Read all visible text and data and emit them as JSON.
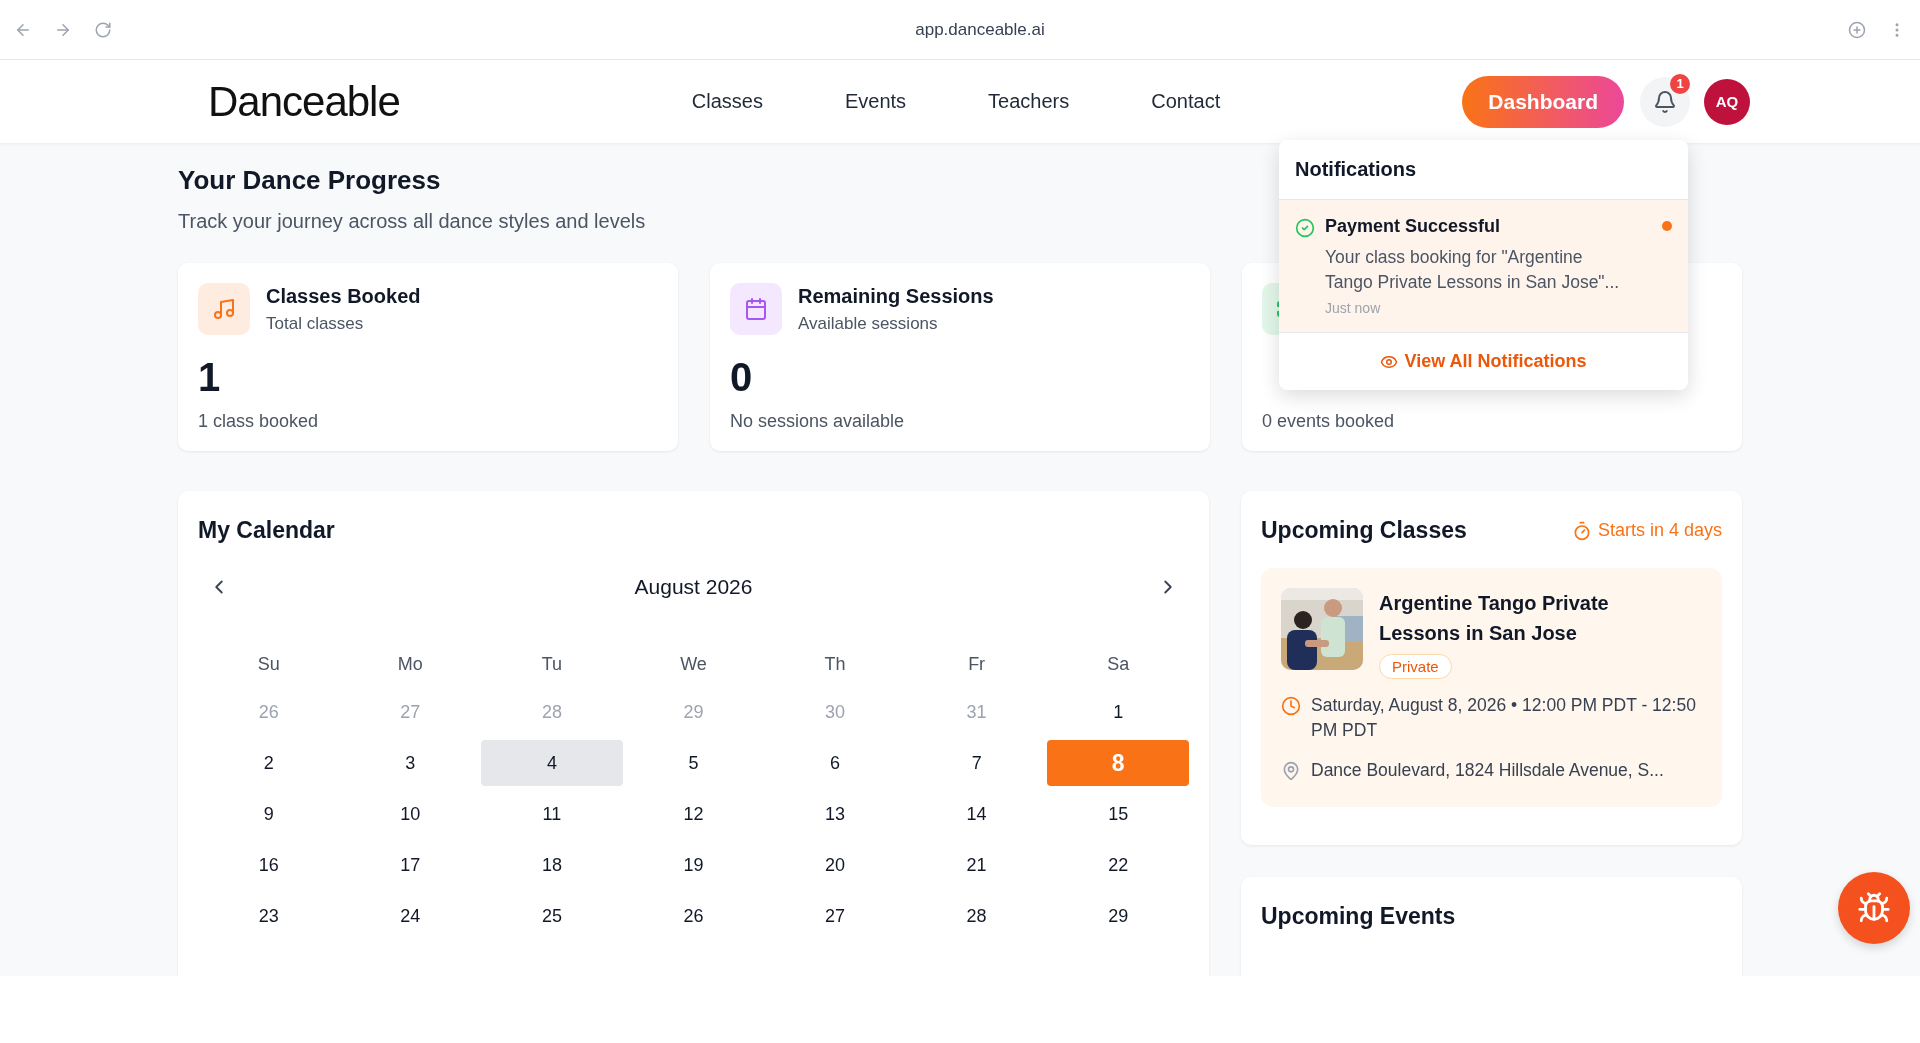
{
  "browser": {
    "url": "app.danceable.ai"
  },
  "header": {
    "logo": "Danceable",
    "nav": [
      {
        "label": "Classes"
      },
      {
        "label": "Events"
      },
      {
        "label": "Teachers"
      },
      {
        "label": "Contact"
      }
    ],
    "dashboard_button": "Dashboard",
    "notification_count": "1",
    "avatar": "AQ"
  },
  "progress": {
    "title": "Your Dance Progress",
    "subtitle": "Track your journey across all dance styles and levels",
    "cards": [
      {
        "kind": "music",
        "color": "#f97316",
        "title": "Classes Booked",
        "subtitle": "Total classes",
        "value": "1",
        "note": "1 class booked"
      },
      {
        "kind": "calendar",
        "color": "#a855f7",
        "title": "Remaining Sessions",
        "subtitle": "Available sessions",
        "value": "0",
        "note": "No sessions available"
      },
      {
        "kind": "ticket",
        "color": "#22c55e",
        "note": "0 events booked"
      }
    ]
  },
  "calendar": {
    "title": "My Calendar",
    "month": "August 2026",
    "weekdays": [
      "Su",
      "Mo",
      "Tu",
      "We",
      "Th",
      "Fr",
      "Sa"
    ],
    "weeks": [
      [
        {
          "day": "26",
          "kind": "outside",
          "selected": false
        },
        {
          "day": "27",
          "kind": "outside",
          "selected": false
        },
        {
          "day": "28",
          "kind": "outside",
          "selected": false
        },
        {
          "day": "29",
          "kind": "outside",
          "selected": false
        },
        {
          "day": "30",
          "kind": "outside",
          "selected": false
        },
        {
          "day": "31",
          "kind": "outside",
          "selected": false
        },
        {
          "day": "1",
          "kind": "day",
          "selected": false
        }
      ],
      [
        {
          "day": "2",
          "kind": "day",
          "selected": false
        },
        {
          "day": "3",
          "kind": "day",
          "selected": false
        },
        {
          "day": "4",
          "kind": "today",
          "selected": false
        },
        {
          "day": "5",
          "kind": "day",
          "selected": false
        },
        {
          "day": "6",
          "kind": "day",
          "selected": false
        },
        {
          "day": "7",
          "kind": "day",
          "selected": false
        },
        {
          "day": "8",
          "kind": "day",
          "selected": true
        }
      ],
      [
        {
          "day": "9",
          "kind": "day",
          "selected": false
        },
        {
          "day": "10",
          "kind": "day",
          "selected": false
        },
        {
          "day": "11",
          "kind": "day",
          "selected": false
        },
        {
          "day": "12",
          "kind": "day",
          "selected": false
        },
        {
          "day": "13",
          "kind": "day",
          "selected": false
        },
        {
          "day": "14",
          "kind": "day",
          "selected": false
        },
        {
          "day": "15",
          "kind": "day",
          "selected": false
        }
      ],
      [
        {
          "day": "16",
          "kind": "day",
          "selected": false
        },
        {
          "day": "17",
          "kind": "day",
          "selected": false
        },
        {
          "day": "18",
          "kind": "day",
          "selected": false
        },
        {
          "day": "19",
          "kind": "day",
          "selected": false
        },
        {
          "day": "20",
          "kind": "day",
          "selected": false
        },
        {
          "day": "21",
          "kind": "day",
          "selected": false
        },
        {
          "day": "22",
          "kind": "day",
          "selected": false
        }
      ],
      [
        {
          "day": "23",
          "kind": "day",
          "selected": false
        },
        {
          "day": "24",
          "kind": "day",
          "selected": false
        },
        {
          "day": "25",
          "kind": "day",
          "selected": false
        },
        {
          "day": "26",
          "kind": "day",
          "selected": false
        },
        {
          "day": "27",
          "kind": "day",
          "selected": false
        },
        {
          "day": "28",
          "kind": "day",
          "selected": false
        },
        {
          "day": "29",
          "kind": "day",
          "selected": false
        }
      ]
    ]
  },
  "upcoming_classes": {
    "title": "Upcoming Classes",
    "countdown": "Starts in 4 days",
    "items": [
      {
        "title": "Argentine Tango Private Lessons in San Jose",
        "tag": "Private",
        "schedule": "Saturday, August 8, 2026 • 12:00 PM PDT - 12:50 PM PDT",
        "location": "Dance Boulevard, 1824 Hillsdale Avenue, S..."
      }
    ]
  },
  "upcoming_events": {
    "title": "Upcoming Events"
  },
  "notifications": {
    "title": "Notifications",
    "items": [
      {
        "title": "Payment Successful",
        "body": "Your class booking for \"Argentine Tango Private Lessons in San Jose\"...",
        "time": "Just now",
        "unread": true
      }
    ],
    "view_all": "View All Notifications"
  }
}
